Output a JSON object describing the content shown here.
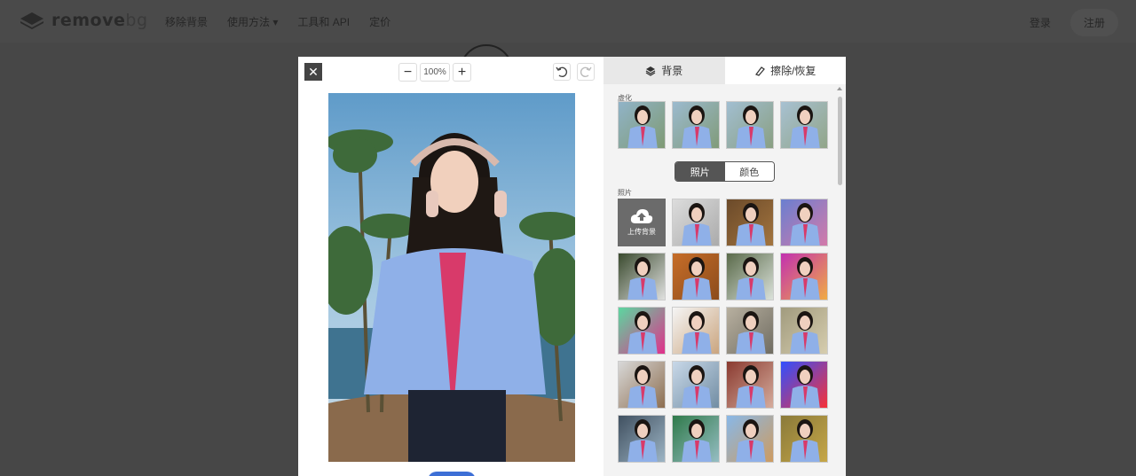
{
  "site": {
    "logo": {
      "main": "remove",
      "suffix": "bg"
    },
    "nav": [
      "移除背景",
      "使用方法 ▾",
      "工具和 API",
      "定价"
    ],
    "login": "登录",
    "signup": "注册"
  },
  "editor": {
    "close_label": "✕",
    "zoom": {
      "minus": "−",
      "value": "100%",
      "plus": "+"
    },
    "tabs": {
      "background": "背景",
      "erase_restore": "擦除/恢复"
    },
    "blur_label": "虚化",
    "toggle": {
      "photo": "照片",
      "color": "颜色"
    },
    "photo_label": "照片",
    "upload_label": "上传背景"
  },
  "colors": {
    "overlay": "#474747",
    "accent": "#3d6fd6",
    "toggle_active": "#555555",
    "panel_bg": "#f3f3f3"
  },
  "icons": [
    "close-icon",
    "minus-icon",
    "plus-icon",
    "undo-icon",
    "redo-icon",
    "layers-icon",
    "eraser-icon",
    "upload-cloud-icon"
  ]
}
